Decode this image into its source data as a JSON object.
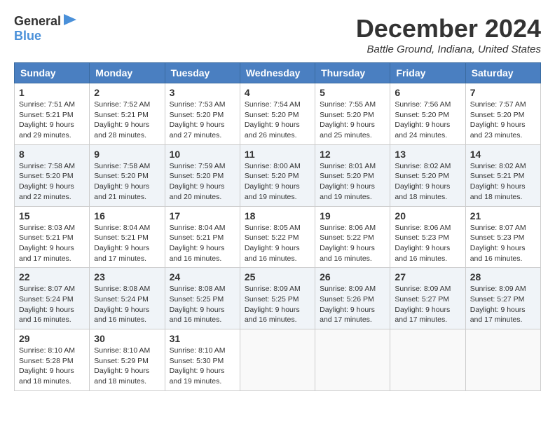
{
  "logo": {
    "general": "General",
    "blue": "Blue"
  },
  "title": {
    "month": "December 2024",
    "location": "Battle Ground, Indiana, United States"
  },
  "calendar": {
    "headers": [
      "Sunday",
      "Monday",
      "Tuesday",
      "Wednesday",
      "Thursday",
      "Friday",
      "Saturday"
    ],
    "weeks": [
      [
        {
          "day": "1",
          "sunrise": "7:51 AM",
          "sunset": "5:21 PM",
          "daylight": "9 hours and 29 minutes."
        },
        {
          "day": "2",
          "sunrise": "7:52 AM",
          "sunset": "5:21 PM",
          "daylight": "9 hours and 28 minutes."
        },
        {
          "day": "3",
          "sunrise": "7:53 AM",
          "sunset": "5:20 PM",
          "daylight": "9 hours and 27 minutes."
        },
        {
          "day": "4",
          "sunrise": "7:54 AM",
          "sunset": "5:20 PM",
          "daylight": "9 hours and 26 minutes."
        },
        {
          "day": "5",
          "sunrise": "7:55 AM",
          "sunset": "5:20 PM",
          "daylight": "9 hours and 25 minutes."
        },
        {
          "day": "6",
          "sunrise": "7:56 AM",
          "sunset": "5:20 PM",
          "daylight": "9 hours and 24 minutes."
        },
        {
          "day": "7",
          "sunrise": "7:57 AM",
          "sunset": "5:20 PM",
          "daylight": "9 hours and 23 minutes."
        }
      ],
      [
        {
          "day": "8",
          "sunrise": "7:58 AM",
          "sunset": "5:20 PM",
          "daylight": "9 hours and 22 minutes."
        },
        {
          "day": "9",
          "sunrise": "7:58 AM",
          "sunset": "5:20 PM",
          "daylight": "9 hours and 21 minutes."
        },
        {
          "day": "10",
          "sunrise": "7:59 AM",
          "sunset": "5:20 PM",
          "daylight": "9 hours and 20 minutes."
        },
        {
          "day": "11",
          "sunrise": "8:00 AM",
          "sunset": "5:20 PM",
          "daylight": "9 hours and 19 minutes."
        },
        {
          "day": "12",
          "sunrise": "8:01 AM",
          "sunset": "5:20 PM",
          "daylight": "9 hours and 19 minutes."
        },
        {
          "day": "13",
          "sunrise": "8:02 AM",
          "sunset": "5:20 PM",
          "daylight": "9 hours and 18 minutes."
        },
        {
          "day": "14",
          "sunrise": "8:02 AM",
          "sunset": "5:21 PM",
          "daylight": "9 hours and 18 minutes."
        }
      ],
      [
        {
          "day": "15",
          "sunrise": "8:03 AM",
          "sunset": "5:21 PM",
          "daylight": "9 hours and 17 minutes."
        },
        {
          "day": "16",
          "sunrise": "8:04 AM",
          "sunset": "5:21 PM",
          "daylight": "9 hours and 17 minutes."
        },
        {
          "day": "17",
          "sunrise": "8:04 AM",
          "sunset": "5:21 PM",
          "daylight": "9 hours and 16 minutes."
        },
        {
          "day": "18",
          "sunrise": "8:05 AM",
          "sunset": "5:22 PM",
          "daylight": "9 hours and 16 minutes."
        },
        {
          "day": "19",
          "sunrise": "8:06 AM",
          "sunset": "5:22 PM",
          "daylight": "9 hours and 16 minutes."
        },
        {
          "day": "20",
          "sunrise": "8:06 AM",
          "sunset": "5:23 PM",
          "daylight": "9 hours and 16 minutes."
        },
        {
          "day": "21",
          "sunrise": "8:07 AM",
          "sunset": "5:23 PM",
          "daylight": "9 hours and 16 minutes."
        }
      ],
      [
        {
          "day": "22",
          "sunrise": "8:07 AM",
          "sunset": "5:24 PM",
          "daylight": "9 hours and 16 minutes."
        },
        {
          "day": "23",
          "sunrise": "8:08 AM",
          "sunset": "5:24 PM",
          "daylight": "9 hours and 16 minutes."
        },
        {
          "day": "24",
          "sunrise": "8:08 AM",
          "sunset": "5:25 PM",
          "daylight": "9 hours and 16 minutes."
        },
        {
          "day": "25",
          "sunrise": "8:09 AM",
          "sunset": "5:25 PM",
          "daylight": "9 hours and 16 minutes."
        },
        {
          "day": "26",
          "sunrise": "8:09 AM",
          "sunset": "5:26 PM",
          "daylight": "9 hours and 17 minutes."
        },
        {
          "day": "27",
          "sunrise": "8:09 AM",
          "sunset": "5:27 PM",
          "daylight": "9 hours and 17 minutes."
        },
        {
          "day": "28",
          "sunrise": "8:09 AM",
          "sunset": "5:27 PM",
          "daylight": "9 hours and 17 minutes."
        }
      ],
      [
        {
          "day": "29",
          "sunrise": "8:10 AM",
          "sunset": "5:28 PM",
          "daylight": "9 hours and 18 minutes."
        },
        {
          "day": "30",
          "sunrise": "8:10 AM",
          "sunset": "5:29 PM",
          "daylight": "9 hours and 18 minutes."
        },
        {
          "day": "31",
          "sunrise": "8:10 AM",
          "sunset": "5:30 PM",
          "daylight": "9 hours and 19 minutes."
        },
        null,
        null,
        null,
        null
      ]
    ]
  }
}
